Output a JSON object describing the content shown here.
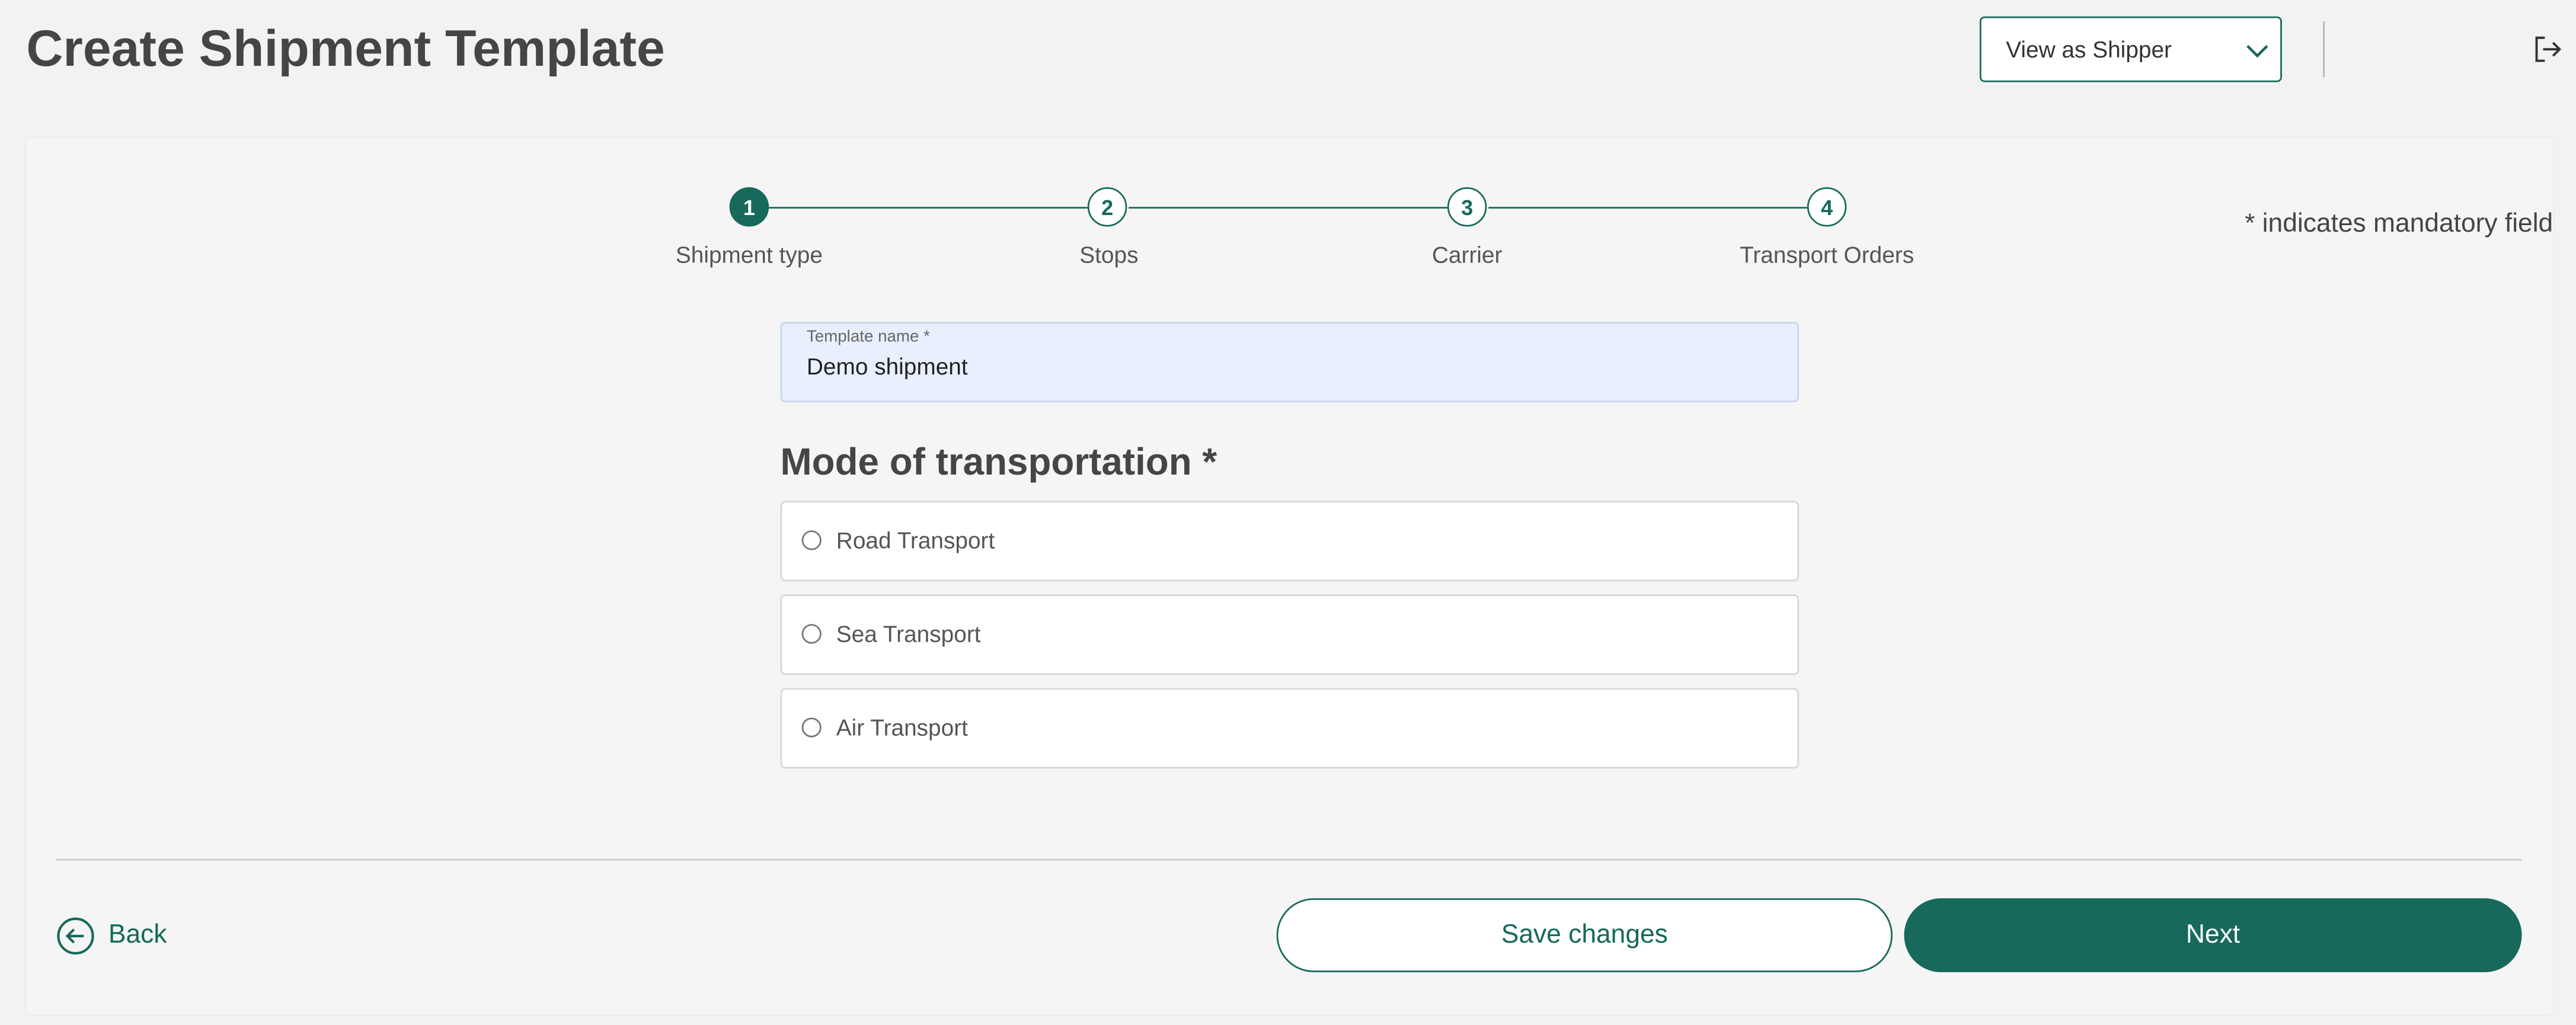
{
  "header": {
    "title": "Create Shipment Template",
    "view_select": {
      "value": "View as Shipper"
    },
    "logout_icon": "logout-icon"
  },
  "stepper": {
    "steps": [
      {
        "number": "1",
        "label": "Shipment type",
        "state": "active"
      },
      {
        "number": "2",
        "label": "Stops",
        "state": "upcoming"
      },
      {
        "number": "3",
        "label": "Carrier",
        "state": "upcoming"
      },
      {
        "number": "4",
        "label": "Transport Orders",
        "state": "upcoming"
      }
    ]
  },
  "form": {
    "mandatory_note": "* indicates mandatory field",
    "template_name": {
      "label": "Template name *",
      "value": "Demo shipment"
    },
    "mode_heading": "Mode of transportation *",
    "mode_options": [
      {
        "label": "Road Transport",
        "selected": false
      },
      {
        "label": "Sea Transport",
        "selected": false
      },
      {
        "label": "Air Transport",
        "selected": false
      }
    ]
  },
  "footer": {
    "back_label": "Back",
    "save_label": "Save changes",
    "next_label": "Next"
  },
  "colors": {
    "accent": "#16695b",
    "background": "#f2f2f2",
    "field_fill": "#e8f0fe"
  }
}
